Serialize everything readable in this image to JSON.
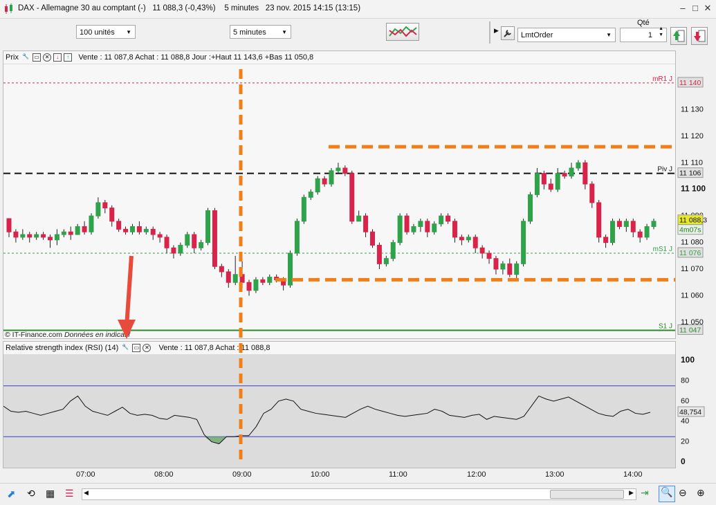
{
  "title": {
    "text": "DAX - Allemagne 30 au comptant (-)",
    "price": "11 088,3 (-0,43%)",
    "interval": "5 minutes",
    "datetime": "23 nov. 2015 14:15 (13:15)"
  },
  "toolbar": {
    "units_value": "100 unités",
    "period_value": "5 minutes",
    "qty_label": "Qté",
    "order_type_value": "LmtOrder",
    "qty_value": "1"
  },
  "price_panel": {
    "label": "Prix",
    "quote": "Vente : 11 087,8 Achat : 11 088,8 Jour :+Haut 11 143,6 +Bas 11 050,8",
    "watermark_source": "© IT-Finance.com",
    "watermark_note": "Données en indicatif",
    "level_labels": {
      "mr1": "mR1 J",
      "piv": "Piv J",
      "ms1": "mS1 J",
      "s1": "S1 J"
    },
    "level_tags": {
      "mr1": "11 140",
      "piv": "11 106",
      "ms1": "11 076",
      "s1": "11 047",
      "last": "11 088,3",
      "timer": "4m07s"
    },
    "y_ticks": [
      "11 130",
      "11 120",
      "11 110",
      "11 100",
      "11 090",
      "11 080",
      "11 070",
      "11 060",
      "11 050"
    ]
  },
  "rsi_panel": {
    "label": "Relative strength index (RSI) (14)",
    "quote": "Vente : 11 087,8 Achat : 11 088,8",
    "last_value": "48,754",
    "y_ticks": [
      "100",
      "80",
      "60",
      "40",
      "20",
      "0"
    ]
  },
  "time_axis": [
    "07:00",
    "08:00",
    "09:00",
    "10:00",
    "11:00",
    "12:00",
    "13:00",
    "14:00"
  ],
  "colors": {
    "up": "#2fa24a",
    "down": "#d9234a",
    "annotation": "#f07f18",
    "arrow": "#e84a3c",
    "last_tag": "#e8e82a"
  },
  "chart_data": {
    "type": "candlestick",
    "ylim": [
      11044,
      11147
    ],
    "levels": {
      "mR1": 11140,
      "Piv": 11106,
      "mS1": 11076,
      "S1": 11047
    },
    "candles": [
      [
        11089,
        11084,
        11089,
        11082
      ],
      [
        11084,
        11082,
        11085,
        11080
      ],
      [
        11082,
        11083,
        11085,
        11081
      ],
      [
        11083,
        11082,
        11084,
        11080
      ],
      [
        11082,
        11083,
        11084,
        11081
      ],
      [
        11083,
        11082,
        11084,
        11081
      ],
      [
        11082,
        11081,
        11083,
        11078
      ],
      [
        11081,
        11083,
        11085,
        11079
      ],
      [
        11083,
        11084,
        11085,
        11082
      ],
      [
        11084,
        11083,
        11086,
        11081
      ],
      [
        11083,
        11086,
        11087,
        11083
      ],
      [
        11086,
        11084,
        11088,
        11083
      ],
      [
        11084,
        11090,
        11091,
        11083
      ],
      [
        11090,
        11095,
        11097,
        11089
      ],
      [
        11095,
        11093,
        11096,
        11091
      ],
      [
        11093,
        11088,
        11094,
        11086
      ],
      [
        11088,
        11085,
        11089,
        11084
      ],
      [
        11085,
        11084,
        11086,
        11083
      ],
      [
        11084,
        11086,
        11087,
        11083
      ],
      [
        11086,
        11084,
        11088,
        11083
      ],
      [
        11084,
        11085,
        11086,
        11083
      ],
      [
        11085,
        11083,
        11086,
        11081
      ],
      [
        11083,
        11082,
        11084,
        11080
      ],
      [
        11082,
        11078,
        11083,
        11076
      ],
      [
        11078,
        11076,
        11079,
        11074
      ],
      [
        11076,
        11079,
        11080,
        11075
      ],
      [
        11079,
        11083,
        11084,
        11078
      ],
      [
        11083,
        11078,
        11084,
        11076
      ],
      [
        11078,
        11080,
        11081,
        11077
      ],
      [
        11080,
        11092,
        11093,
        11079
      ],
      [
        11092,
        11071,
        11093,
        11070
      ],
      [
        11071,
        11069,
        11072,
        11067
      ],
      [
        11069,
        11065,
        11070,
        11063
      ],
      [
        11065,
        11068,
        11075,
        11064
      ],
      [
        11068,
        11065,
        11073,
        11063
      ],
      [
        11065,
        11062,
        11066,
        11060
      ],
      [
        11062,
        11066,
        11067,
        11061
      ],
      [
        11066,
        11065,
        11067,
        11064
      ],
      [
        11065,
        11067,
        11068,
        11064
      ],
      [
        11067,
        11066,
        11068,
        11065
      ],
      [
        11066,
        11064,
        11067,
        11062
      ],
      [
        11064,
        11076,
        11077,
        11063
      ],
      [
        11076,
        11088,
        11089,
        11075
      ],
      [
        11088,
        11097,
        11098,
        11087
      ],
      [
        11097,
        11099,
        11100,
        11096
      ],
      [
        11099,
        11104,
        11105,
        11098
      ],
      [
        11104,
        11102,
        11105,
        11101
      ],
      [
        11102,
        11107,
        11108,
        11101
      ],
      [
        11107,
        11108,
        11110,
        11106
      ],
      [
        11108,
        11106,
        11109,
        11105
      ],
      [
        11106,
        11088,
        11107,
        11087
      ],
      [
        11088,
        11090,
        11092,
        11088
      ],
      [
        11090,
        11084,
        11091,
        11082
      ],
      [
        11084,
        11079,
        11085,
        11078
      ],
      [
        11079,
        11072,
        11080,
        11070
      ],
      [
        11072,
        11074,
        11075,
        11071
      ],
      [
        11074,
        11080,
        11081,
        11073
      ],
      [
        11080,
        11090,
        11091,
        11079
      ],
      [
        11090,
        11084,
        11091,
        11083
      ],
      [
        11084,
        11086,
        11087,
        11083
      ],
      [
        11086,
        11088,
        11089,
        11084
      ],
      [
        11088,
        11084,
        11089,
        11082
      ],
      [
        11084,
        11087,
        11088,
        11083
      ],
      [
        11087,
        11090,
        11091,
        11086
      ],
      [
        11090,
        11088,
        11091,
        11087
      ],
      [
        11088,
        11082,
        11089,
        11080
      ],
      [
        11082,
        11081,
        11083,
        11079
      ],
      [
        11081,
        11082,
        11083,
        11080
      ],
      [
        11082,
        11078,
        11083,
        11076
      ],
      [
        11078,
        11076,
        11079,
        11074
      ],
      [
        11076,
        11074,
        11077,
        11072
      ],
      [
        11074,
        11070,
        11075,
        11068
      ],
      [
        11070,
        11072,
        11073,
        11068
      ],
      [
        11072,
        11068,
        11074,
        11067
      ],
      [
        11068,
        11072,
        11073,
        11066
      ],
      [
        11072,
        11088,
        11089,
        11071
      ],
      [
        11088,
        11098,
        11099,
        11087
      ],
      [
        11098,
        11106,
        11108,
        11097
      ],
      [
        11106,
        11102,
        11107,
        11100
      ],
      [
        11102,
        11100,
        11104,
        11099
      ],
      [
        11100,
        11106,
        11108,
        11099
      ],
      [
        11106,
        11105,
        11107,
        11104
      ],
      [
        11105,
        11108,
        11110,
        11104
      ],
      [
        11108,
        11110,
        11111,
        11107
      ],
      [
        11110,
        11102,
        11111,
        11100
      ],
      [
        11102,
        11095,
        11103,
        11093
      ],
      [
        11095,
        11082,
        11096,
        11080
      ],
      [
        11082,
        11080,
        11083,
        11078
      ],
      [
        11080,
        11088,
        11089,
        11079
      ],
      [
        11088,
        11086,
        11089,
        11085
      ],
      [
        11086,
        11088,
        11089,
        11084
      ],
      [
        11088,
        11084,
        11089,
        11082
      ],
      [
        11084,
        11082,
        11085,
        11080
      ],
      [
        11082,
        11086,
        11087,
        11081
      ],
      [
        11086,
        11088,
        11089,
        11085
      ]
    ],
    "rsi_ylim": [
      0,
      100
    ],
    "rsi_levels": [
      25,
      75
    ],
    "rsi": [
      55,
      50,
      49,
      50,
      48,
      46,
      48,
      50,
      52,
      60,
      65,
      55,
      50,
      48,
      46,
      50,
      54,
      48,
      46,
      47,
      46,
      43,
      42,
      46,
      45,
      44,
      42,
      27,
      20,
      18,
      25,
      25,
      26,
      26,
      35,
      48,
      52,
      60,
      62,
      60,
      52,
      50,
      48,
      47,
      46,
      45,
      44,
      48,
      52,
      55,
      52,
      50,
      48,
      46,
      45,
      46,
      47,
      48,
      52,
      50,
      46,
      45,
      44,
      46,
      47,
      42,
      45,
      44,
      43,
      42,
      45,
      55,
      65,
      62,
      60,
      62,
      64,
      60,
      56,
      52,
      48,
      46,
      45,
      50,
      52,
      48,
      47,
      49
    ]
  }
}
